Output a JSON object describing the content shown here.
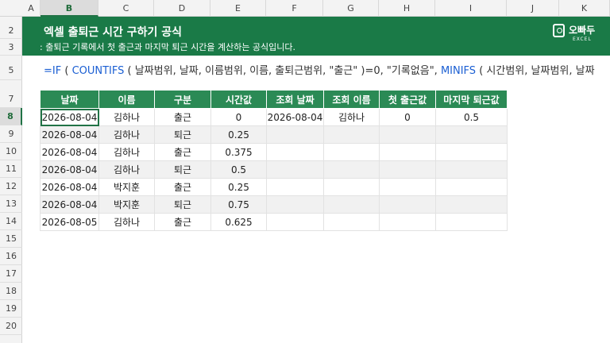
{
  "columns": [
    "A",
    "B",
    "C",
    "D",
    "E",
    "F",
    "G",
    "H",
    "I",
    "J",
    "K"
  ],
  "rows": [
    "2",
    "3",
    "5",
    "7",
    "8",
    "9",
    "10",
    "11",
    "12",
    "13",
    "14",
    "15",
    "16",
    "17",
    "18",
    "19",
    "20"
  ],
  "selected_column": "B",
  "selected_row": "8",
  "banner": {
    "title": "엑셀 출퇴근 시간 구하기 공식",
    "subtitle": ": 출퇴근 기록에서 첫 출근과 마지막 퇴근 시간을 계산하는 공식입니다.",
    "logo_text": "오빠두",
    "logo_sub": "EXCEL"
  },
  "formula": {
    "part1": "=IF",
    "part2": " ( ",
    "part3": "COUNTIFS",
    "part4": " ( 날짜범위, 날짜, 이름범위, 이름, 출퇴근범위, \"출근\" )=0, \"기록없음\", ",
    "part5": "MINIFS",
    "part6": " ( 시간범위, 날짜범위, 날짜"
  },
  "table": {
    "headers": [
      "날짜",
      "이름",
      "구분",
      "시간값",
      "조회 날짜",
      "조회 이름",
      "첫 출근값",
      "마지막 퇴근값"
    ],
    "rows": [
      [
        "2026-08-04",
        "김하나",
        "출근",
        "0",
        "2026-08-04",
        "김하나",
        "0",
        "0.5"
      ],
      [
        "2026-08-04",
        "김하나",
        "퇴근",
        "0.25",
        "",
        "",
        "",
        ""
      ],
      [
        "2026-08-04",
        "김하나",
        "출근",
        "0.375",
        "",
        "",
        "",
        ""
      ],
      [
        "2026-08-04",
        "김하나",
        "퇴근",
        "0.5",
        "",
        "",
        "",
        ""
      ],
      [
        "2026-08-04",
        "박지훈",
        "출근",
        "0.25",
        "",
        "",
        "",
        ""
      ],
      [
        "2026-08-04",
        "박지훈",
        "퇴근",
        "0.75",
        "",
        "",
        "",
        ""
      ],
      [
        "2026-08-05",
        "김하나",
        "출근",
        "0.625",
        "",
        "",
        "",
        ""
      ]
    ]
  }
}
